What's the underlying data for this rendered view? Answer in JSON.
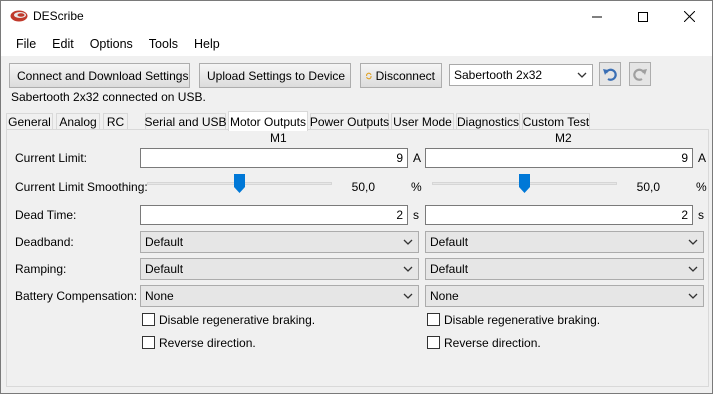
{
  "window": {
    "title": "DEScribe",
    "controls": {
      "minimize": "minimize-icon",
      "maximize": "maximize-icon",
      "close": "close-icon"
    }
  },
  "menu": [
    "File",
    "Edit",
    "Options",
    "Tools",
    "Help"
  ],
  "toolbar": {
    "connect_download": "Connect and Download Settings",
    "upload": "Upload Settings to Device",
    "disconnect": "Disconnect",
    "device_select": "Sabertooth 2x32",
    "undo_icon": "undo-icon",
    "redo_icon": "redo-icon"
  },
  "status": "Sabertooth 2x32 connected on USB.",
  "tabs": [
    "General",
    "Analog",
    "RC",
    "Serial and USB",
    "Motor Outputs",
    "Power Outputs",
    "User Mode",
    "Diagnostics",
    "Custom Test"
  ],
  "active_tab": "Motor Outputs",
  "motor_outputs": {
    "columns": [
      "M1",
      "M2"
    ],
    "rows": {
      "current_limit": "Current Limit:",
      "current_limit_smoothing": "Current Limit Smoothing:",
      "dead_time": "Dead Time:",
      "deadband": "Deadband:",
      "ramping": "Ramping:",
      "battery_compensation": "Battery Compensation:"
    },
    "m1": {
      "current_limit": "9",
      "current_limit_unit": "A",
      "smoothing_value": "50,0",
      "smoothing_unit": "%",
      "smoothing_level": 0.5,
      "dead_time": "2",
      "dead_time_unit": "s",
      "deadband": "Default",
      "ramping": "Default",
      "battery_compensation": "None",
      "disable_regen": "Disable regenerative braking.",
      "reverse": "Reverse direction."
    },
    "m2": {
      "current_limit": "9",
      "current_limit_unit": "A",
      "smoothing_value": "50,0",
      "smoothing_unit": "%",
      "smoothing_level": 0.5,
      "dead_time": "2",
      "dead_time_unit": "s",
      "deadband": "Default",
      "ramping": "Default",
      "battery_compensation": "None",
      "disable_regen": "Disable regenerative braking.",
      "reverse": "Reverse direction."
    }
  }
}
